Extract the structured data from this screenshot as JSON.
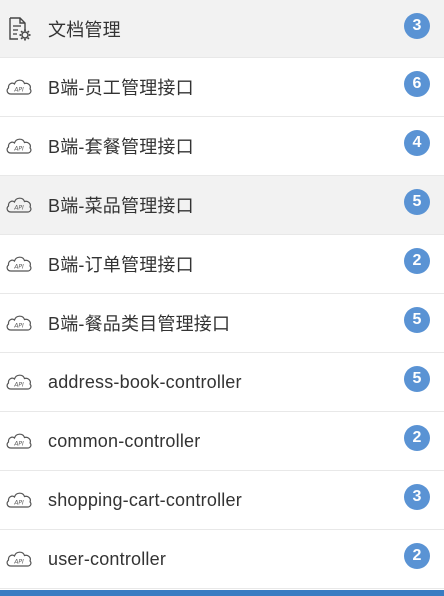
{
  "colors": {
    "badge": "#5a93d4",
    "header_bg": "#f2f2f2",
    "active_bg": "#f2f2f2",
    "bottom_bar": "#3a7cc2"
  },
  "menu": {
    "header": {
      "label": "文档管理",
      "count": "3",
      "icon": "document-settings-icon"
    },
    "items": [
      {
        "label": "B端-员工管理接口",
        "count": "6",
        "icon": "api-cloud-icon"
      },
      {
        "label": "B端-套餐管理接口",
        "count": "4",
        "icon": "api-cloud-icon"
      },
      {
        "label": "B端-菜品管理接口",
        "count": "5",
        "icon": "api-cloud-icon"
      },
      {
        "label": "B端-订单管理接口",
        "count": "2",
        "icon": "api-cloud-icon"
      },
      {
        "label": "B端-餐品类目管理接口",
        "count": "5",
        "icon": "api-cloud-icon"
      },
      {
        "label": "address-book-controller",
        "count": "5",
        "icon": "api-cloud-icon"
      },
      {
        "label": "common-controller",
        "count": "2",
        "icon": "api-cloud-icon"
      },
      {
        "label": "shopping-cart-controller",
        "count": "3",
        "icon": "api-cloud-icon"
      },
      {
        "label": "user-controller",
        "count": "2",
        "icon": "api-cloud-icon"
      }
    ]
  }
}
